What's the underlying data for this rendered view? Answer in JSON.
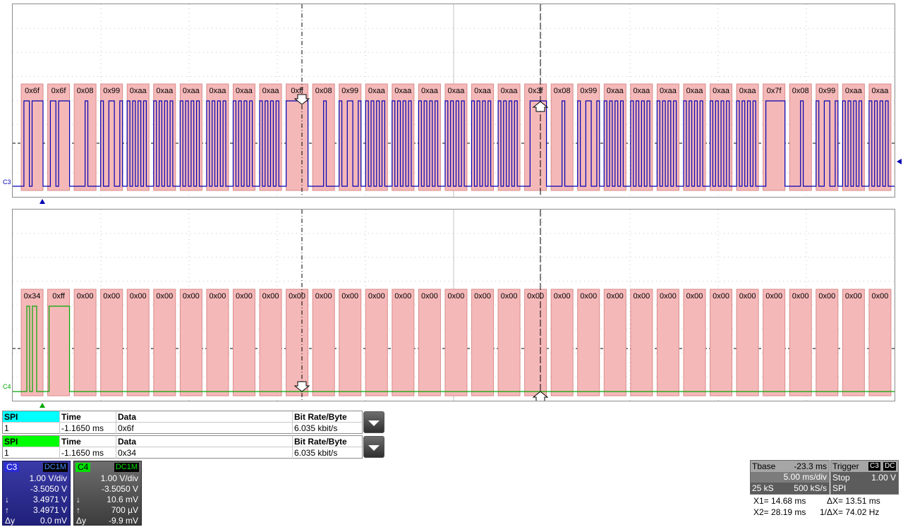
{
  "colors": {
    "c3_trace": "#0000b4",
    "c4_trace": "#00a800",
    "decode_box": "#f5b8b8",
    "decode_border": "#d98c8c",
    "grid": "#b4b4b4",
    "c3_badge": "#00ffff",
    "c4_badge": "#00ff00"
  },
  "c3": {
    "label": "C3",
    "bytes": [
      "0x6f",
      "0x6f",
      "0x08",
      "0x99",
      "0xaa",
      "0xaa",
      "0xaa",
      "0xaa",
      "0xaa",
      "0xaa",
      "0xff",
      "0x08",
      "0x99",
      "0xaa",
      "0xaa",
      "0xaa",
      "0xaa",
      "0xaa",
      "0xaa",
      "0x3f",
      "0x08",
      "0x99",
      "0xaa",
      "0xaa",
      "0xaa",
      "0xaa",
      "0xaa",
      "0xaa",
      "0x7f",
      "0x08",
      "0x99",
      "0xaa",
      "0xaa"
    ]
  },
  "c4": {
    "label": "C4",
    "bytes": [
      "0x34",
      "0xff",
      "0x00",
      "0x00",
      "0x00",
      "0x00",
      "0x00",
      "0x00",
      "0x00",
      "0x00",
      "0x00",
      "0x00",
      "0x00",
      "0x00",
      "0x00",
      "0x00",
      "0x00",
      "0x00",
      "0x00",
      "0x00",
      "0x00",
      "0x00",
      "0x00",
      "0x00",
      "0x00",
      "0x00",
      "0x00",
      "0x00",
      "0x00",
      "0x00",
      "0x00",
      "0x00",
      "0x00"
    ]
  },
  "table_c3": {
    "badge": "SPI",
    "col_time": "Time",
    "col_data": "Data",
    "col_rate": "Bit Rate/Byte",
    "idx": "1",
    "time": "-1.1650 ms",
    "data": "0x6f",
    "rate": "6.035 kbit/s"
  },
  "table_c4": {
    "badge": "SPI",
    "col_time": "Time",
    "col_data": "Data",
    "col_rate": "Bit Rate/Byte",
    "idx": "1",
    "time": "-1.1650 ms",
    "data": "0x34",
    "rate": "6.035 kbit/s"
  },
  "ch3_box": {
    "name": "C3",
    "coupling": "DC1M",
    "vdiv": "1.00 V/div",
    "offset": "-3.5050 V",
    "down_sym": "↓",
    "down_val": "3.4971 V",
    "up_sym": "↑",
    "up_val": "3.4971 V",
    "dy_label": "Δy",
    "dy_val": "0.0 mV"
  },
  "ch4_box": {
    "name": "C4",
    "coupling": "DC1M",
    "vdiv": "1.00 V/div",
    "offset": "-3.5050 V",
    "down_sym": "↓",
    "down_val": "10.6 mV",
    "up_sym": "↑",
    "up_val": "700 µV",
    "dy_label": "Δy",
    "dy_val": "-9.9 mV"
  },
  "tbase": {
    "label": "Tbase",
    "delay": "-23.3 ms",
    "tdiv": "5.00 ms/div",
    "samples": "25 kS",
    "rate": "500 kS/s"
  },
  "trigger": {
    "label": "Trigger",
    "source": "C3",
    "coupling": "DC",
    "mode": "Stop",
    "level": "1.00 V",
    "type": "SPI"
  },
  "cursors": {
    "x1": "X1=  14.68 ms",
    "dx": "ΔX=  13.51 ms",
    "x2": "X2=  28.19 ms",
    "inv_dx": "1/ΔX=  74.02 Hz"
  }
}
